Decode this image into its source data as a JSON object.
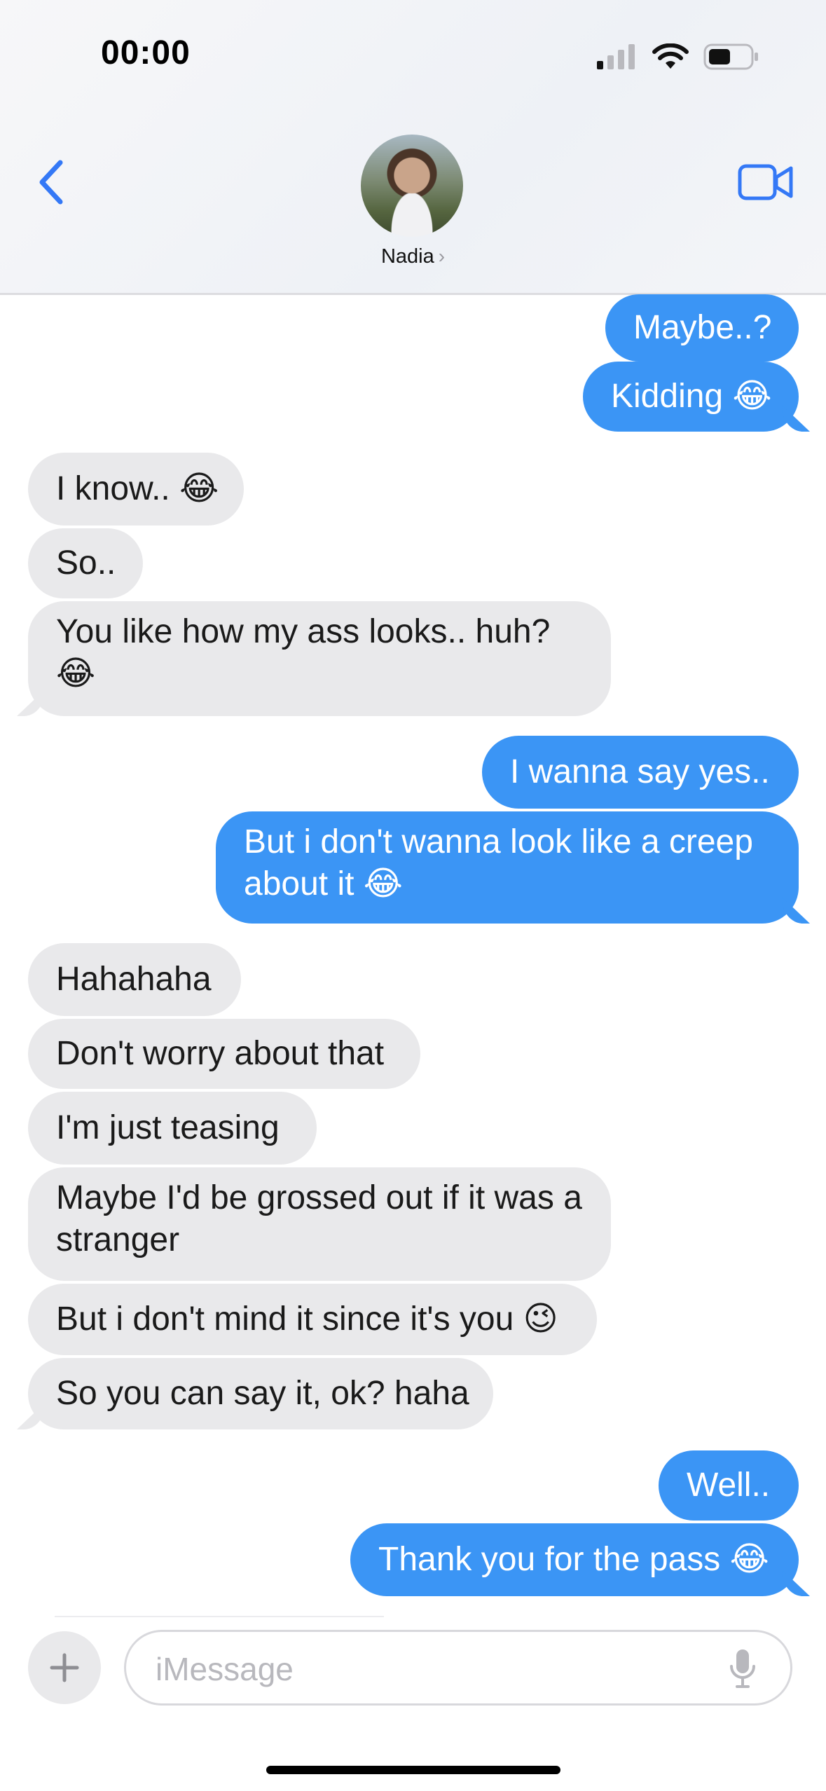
{
  "status_bar": {
    "time": "00:00",
    "icons": [
      "signal-icon",
      "wifi-icon",
      "battery-icon"
    ]
  },
  "header": {
    "back_icon": "chevron-left-icon",
    "contact_name": "Nadia",
    "name_chevron": "›",
    "video_icon": "video-camera-icon"
  },
  "colors": {
    "outgoing_bubble": "#3b95f5",
    "incoming_bubble": "#e9e9eb",
    "accent": "#3478f6"
  },
  "messages": [
    {
      "dir": "out",
      "text": "Maybe..?"
    },
    {
      "dir": "out",
      "text": "Kidding 😂"
    },
    {
      "dir": "in",
      "text": "I know.. 😂"
    },
    {
      "dir": "in",
      "text": "So.."
    },
    {
      "dir": "in",
      "text": "You like how my ass looks.. huh? 😂"
    },
    {
      "dir": "out",
      "text": "I wanna say yes.."
    },
    {
      "dir": "out",
      "text": "But i don't wanna look like a creep about it 😂"
    },
    {
      "dir": "in",
      "text": "Hahahaha"
    },
    {
      "dir": "in",
      "text": "Don't worry about that"
    },
    {
      "dir": "in",
      "text": "I'm just teasing"
    },
    {
      "dir": "in",
      "text": "Maybe I'd be grossed out if it was a stranger"
    },
    {
      "dir": "in",
      "text": "But i don't mind it since it's you 😉"
    },
    {
      "dir": "in",
      "text": "So you can say it, ok? haha"
    },
    {
      "dir": "out",
      "text": "Well.."
    },
    {
      "dir": "out",
      "text": "Thank you for the pass 😂"
    }
  ],
  "composer": {
    "plus_icon": "plus-icon",
    "placeholder": "iMessage",
    "value": "",
    "mic_icon": "microphone-icon"
  }
}
